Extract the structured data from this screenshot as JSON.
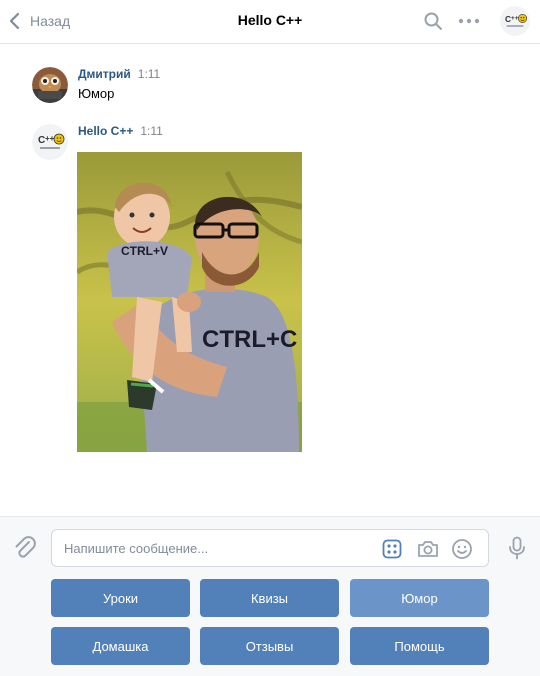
{
  "header": {
    "back_label": "Назад",
    "title": "Hello C++"
  },
  "messages": [
    {
      "author": "Дмитрий",
      "time": "1:11",
      "text": "Юмор"
    },
    {
      "author": "Hello C++",
      "time": "1:11",
      "text": ""
    }
  ],
  "photo": {
    "shirt_child": "CTRL+V",
    "shirt_man": "CTRL+C"
  },
  "composer": {
    "placeholder": "Напишите сообщение..."
  },
  "keyboard": {
    "rows": [
      [
        "Уроки",
        "Квизы",
        "Юмор"
      ],
      [
        "Домашка",
        "Отзывы",
        "Помощь"
      ]
    ]
  },
  "colors": {
    "accent": "#5181b8",
    "link": "#2a5885",
    "muted": "#818c99"
  }
}
